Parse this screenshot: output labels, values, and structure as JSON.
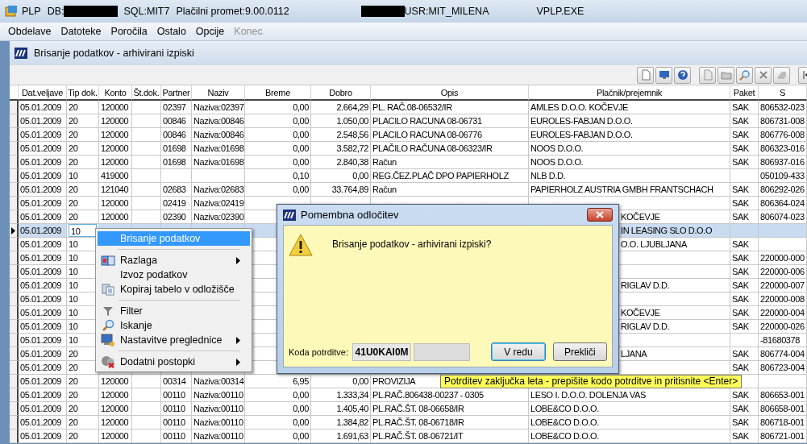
{
  "window": {
    "title_parts": [
      {
        "kind": "text",
        "text": "PLP"
      },
      {
        "kind": "text",
        "text": "DB:"
      },
      {
        "kind": "redaction"
      },
      {
        "kind": "text",
        "text": "SQL:MIT7"
      },
      {
        "kind": "text",
        "text": "Plačilni promet:9.00.0112"
      },
      {
        "kind": "redaction"
      },
      {
        "kind": "text",
        "text": "USR:MIT_MILENA"
      },
      {
        "kind": "text",
        "text": "VPLP.EXE"
      }
    ]
  },
  "menu": [
    {
      "label": "Obdelave",
      "disabled": false
    },
    {
      "label": "Datoteke",
      "disabled": false
    },
    {
      "label": "Poročila",
      "disabled": false
    },
    {
      "label": "Ostalo",
      "disabled": false
    },
    {
      "label": "Opcije",
      "disabled": false
    },
    {
      "label": "Konec",
      "disabled": true
    }
  ],
  "document": {
    "title": "Brisanje podatkov - arhivirani izpiski"
  },
  "table": {
    "columns": [
      "Dat.veljave",
      "Tip dok.",
      "Konto",
      "Št.dok.",
      "Partner",
      "Naziv",
      "Breme",
      "Dobro",
      "Opis",
      "Plačnik/prejemnik",
      "Paket",
      "S"
    ],
    "rows": [
      {
        "selected": false,
        "date": "05.01.2009",
        "tip": "20",
        "konto": "120000",
        "partner": "02397",
        "naziv": "Naziva:02397",
        "breme": "0,00",
        "dobro": "2.664,29",
        "opis": "PL. RAČ.08-06532/IR",
        "placnik": "AMLES D.O.O. KOČEVJE",
        "paket": "SAK",
        "s": "806532-023"
      },
      {
        "selected": false,
        "date": "05.01.2009",
        "tip": "20",
        "konto": "120000",
        "partner": "00846",
        "naziv": "Naziva:00846",
        "breme": "0,00",
        "dobro": "1.050,00",
        "opis": "PLACILO RACUNA 08-06731",
        "placnik": "EUROLES-FABJAN  D.O.O.",
        "paket": "SAK",
        "s": "806731-008"
      },
      {
        "selected": false,
        "date": "05.01.2009",
        "tip": "20",
        "konto": "120000",
        "partner": "00846",
        "naziv": "Naziva:00846",
        "breme": "0,00",
        "dobro": "2.548,56",
        "opis": "PLACILO RACUNA 08-06776",
        "placnik": "EUROLES-FABJAN  D.O.O.",
        "paket": "SAK",
        "s": "806776-008"
      },
      {
        "selected": false,
        "date": "05.01.2009",
        "tip": "20",
        "konto": "120000",
        "partner": "01698",
        "naziv": "Naziva:01698",
        "breme": "0,00",
        "dobro": "3.582,72",
        "opis": "PLAČILO RAČUNA 08-06323/IR",
        "placnik": "NOOS D.O.O.",
        "paket": "SAK",
        "s": "806323-016"
      },
      {
        "selected": false,
        "date": "05.01.2009",
        "tip": "20",
        "konto": "120000",
        "partner": "01698",
        "naziv": "Naziva:01698",
        "breme": "0,00",
        "dobro": "2.840,38",
        "opis": "Račun",
        "placnik": "NOOS D.O.O.",
        "paket": "SAK",
        "s": "806937-016"
      },
      {
        "selected": false,
        "date": "05.01.2009",
        "tip": "10",
        "konto": "419000",
        "breme": "0,10",
        "dobro": "0,00",
        "opis": "REG.ČEZ.PLAČ DPO PAPIERHOLZ",
        "placnik": "NLB D.D.",
        "s": "050109-433"
      },
      {
        "selected": false,
        "date": "05.01.2009",
        "tip": "20",
        "konto": "121040",
        "partner": "02683",
        "naziv": "Naziva:02683",
        "breme": "0,00",
        "dobro": "33.764,89",
        "opis": "Račun",
        "placnik": "PAPIERHOLZ AUSTRIA GMBH FRANTSCHACH",
        "paket": "SAK",
        "s": "806292-026"
      },
      {
        "selected": false,
        "date": "05.01.2009",
        "tip": "20",
        "konto": "120000",
        "partner": "02419",
        "naziv": "Naziva:02419",
        "paket": "SAK",
        "s": "806364-024"
      },
      {
        "selected": false,
        "date": "05.01.2009",
        "tip": "20",
        "konto": "120000",
        "partner": "02390",
        "naziv": "Naziva:02390",
        "placnik_tail": "KOČEVJE",
        "paket": "SAK",
        "s": "806074-023"
      },
      {
        "selected": true,
        "date": "05.01.2009",
        "tip": "10",
        "placnik_tail": "IN LEASING SLO D.O.O"
      },
      {
        "selected": false,
        "date": "05.01.2009",
        "tip": "10",
        "placnik_tail": "O.O. LJUBLJANA",
        "paket": "SAK"
      },
      {
        "selected": false,
        "date": "05.01.2009",
        "tip": "10",
        "paket": "SAK",
        "s": "220000-000"
      },
      {
        "selected": false,
        "date": "05.01.2009",
        "tip": "10",
        "paket": "SAK",
        "s": "220000-006"
      },
      {
        "selected": false,
        "date": "05.01.2009",
        "tip": "10",
        "placnik_tail": "RIGLAV D.D.",
        "paket": "SAK",
        "s": "220000-007"
      },
      {
        "selected": false,
        "date": "05.01.2009",
        "tip": "10",
        "paket": "SAK",
        "s": "220000-008"
      },
      {
        "selected": false,
        "date": "05.01.2009",
        "tip": "10",
        "placnik_tail": "KOČEVJE",
        "paket": "SAK",
        "s": "220000-004"
      },
      {
        "selected": false,
        "date": "05.01.2009",
        "tip": "10",
        "placnik_tail": "RIGLAV D.D.",
        "paket": "SAK",
        "s": "220000-026"
      },
      {
        "selected": false,
        "date": "05.01.2009",
        "tip": "10",
        "s": "-81680378"
      },
      {
        "selected": false,
        "date": "05.01.2009",
        "tip": "20",
        "placnik_tail": "LJANA",
        "paket": "SAK",
        "s": "806774-004"
      },
      {
        "selected": false,
        "date": "05.01.2009",
        "tip": "20",
        "paket": "SAK",
        "s": "806723-004"
      },
      {
        "selected": false,
        "date": "05.01.2009",
        "tip": "20",
        "konto": "120000",
        "partner": "00314",
        "naziv": "Naziva:00314",
        "breme": "6,95",
        "dobro": "0,00",
        "opis": "PROVIZIJA"
      },
      {
        "selected": false,
        "date": "05.01.2009",
        "tip": "20",
        "konto": "120000",
        "partner": "00110",
        "naziv": "Naziva:00110",
        "breme": "0,00",
        "dobro": "1.333,34",
        "opis": "PL.RAČ.806438-00237 - 0305",
        "placnik": "LESO I. D.O.O. DOLENJA VAS",
        "paket": "SAK",
        "s": "806653-001"
      },
      {
        "selected": false,
        "date": "05.01.2009",
        "tip": "20",
        "konto": "120000",
        "partner": "00110",
        "naziv": "Naziva:00110",
        "breme": "0,00",
        "dobro": "1.405,40",
        "opis": "PL.RAČ.ŠT. 08-06658/IR",
        "placnik": "LOBE&CO D.O.O.",
        "paket": "SAK",
        "s": "806658-001"
      },
      {
        "selected": false,
        "date": "05.01.2009",
        "tip": "20",
        "konto": "120000",
        "partner": "00110",
        "naziv": "Naziva:00110",
        "breme": "0,00",
        "dobro": "1.384,82",
        "opis": "PL.RAČ.ŠT. 08-06718/IR",
        "placnik": "LOBE&CO D.O.O.",
        "paket": "SAK",
        "s": "806718-001"
      },
      {
        "selected": false,
        "date": "05.01.2009",
        "tip": "20",
        "konto": "120000",
        "partner": "00110",
        "naziv": "Naziva:00110",
        "breme": "0,00",
        "dobro": "1.691,63",
        "opis": "PL.RAČ.ŠT. 08-06721/IT",
        "placnik": "LOBE&CO D.O.O.",
        "paket": "SAK",
        "s": "806721-001"
      }
    ]
  },
  "context_menu": {
    "items": [
      {
        "kind": "item",
        "label": "Brisanje podatkov",
        "selected": true,
        "submenu": false
      },
      {
        "kind": "separator"
      },
      {
        "kind": "item",
        "label": "Razlaga",
        "selected": false,
        "submenu": true
      },
      {
        "kind": "item",
        "label": "Izvoz podatkov",
        "selected": false,
        "submenu": false
      },
      {
        "kind": "item",
        "label": "Kopiraj tabelo v odložišče",
        "selected": false,
        "submenu": false
      },
      {
        "kind": "separator"
      },
      {
        "kind": "item",
        "label": "Filter",
        "selected": false,
        "submenu": false
      },
      {
        "kind": "item",
        "label": "Iskanje",
        "selected": false,
        "submenu": false
      },
      {
        "kind": "item",
        "label": "Nastavitve preglednice",
        "selected": false,
        "submenu": true
      },
      {
        "kind": "separator"
      },
      {
        "kind": "item",
        "label": "Dodatni postopki",
        "selected": false,
        "submenu": true
      }
    ]
  },
  "dialog": {
    "title": "Pomembna odločitev",
    "message": "Brisanje podatkov - arhivirani izpiski?",
    "code_label": "Koda potrditve:",
    "code": "41U0KAI0M",
    "buttons": [
      {
        "label": "V redu",
        "default": true
      },
      {
        "label": "Prekliči",
        "default": false
      }
    ]
  },
  "tooltip": {
    "text": "Potrditev zaključka leta - prepišite kodo potrditve in pritisnite <Enter>"
  }
}
